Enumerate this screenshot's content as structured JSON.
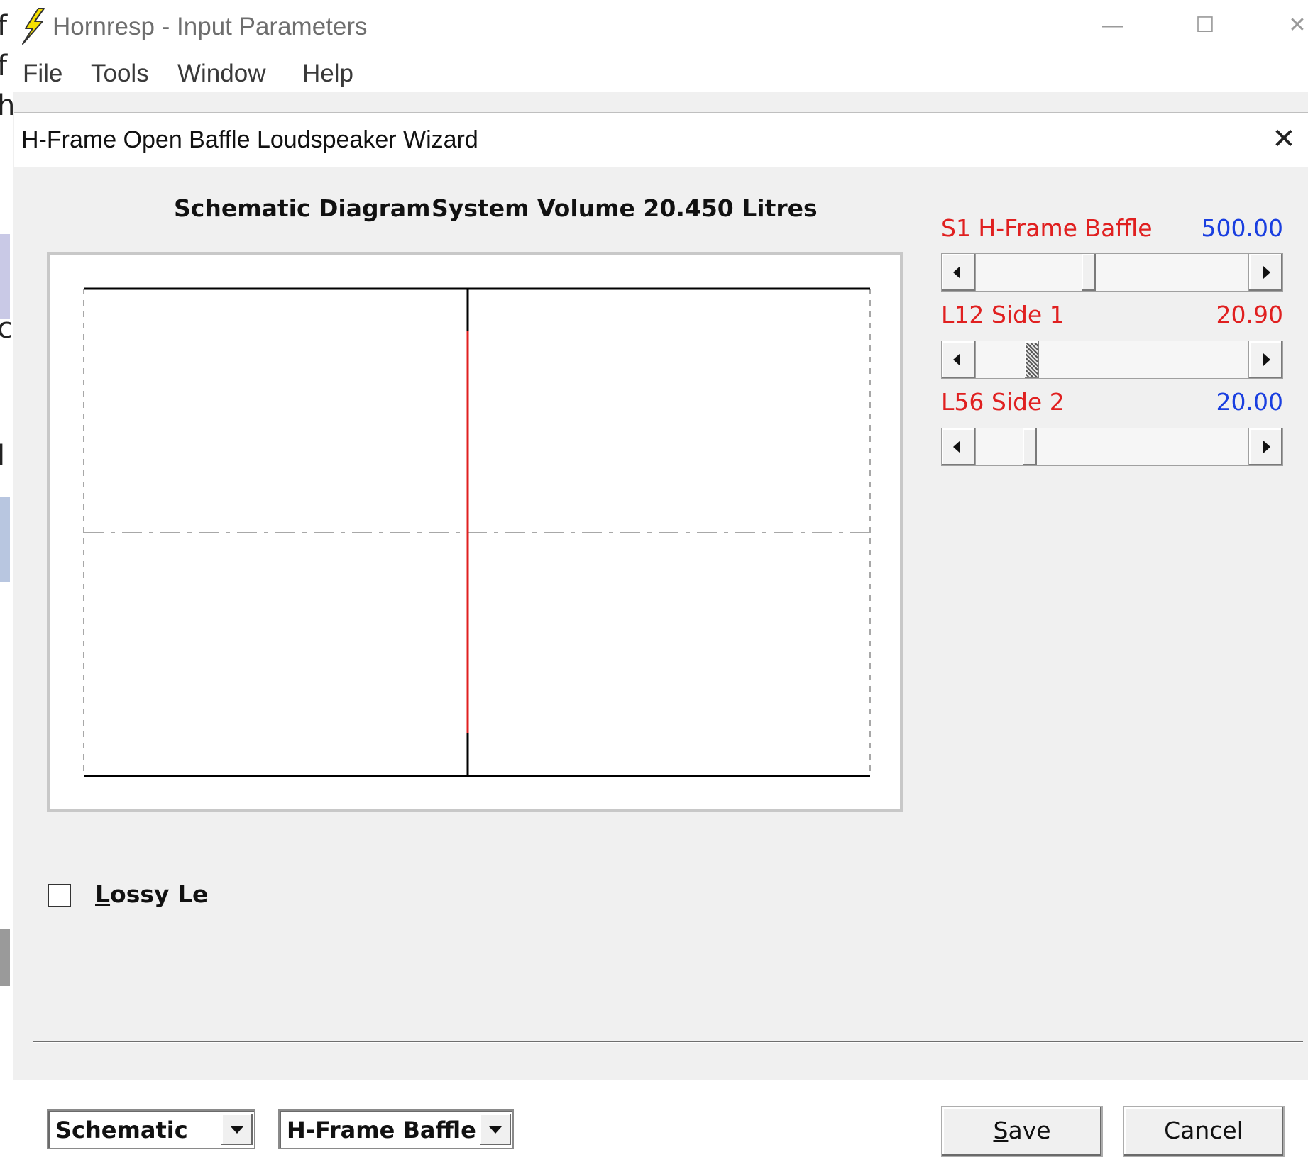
{
  "app": {
    "title": "Hornresp - Input Parameters",
    "menu": [
      "File",
      "Tools",
      "Window",
      "Help"
    ],
    "controls": {
      "minimize": "—",
      "maximize": "☐",
      "close": "✕"
    }
  },
  "dialog": {
    "title": "H-Frame Open Baffle Loudspeaker Wizard",
    "close": "✕",
    "heading_left": "Schematic Diagram",
    "heading_right": "System Volume 20.450 Litres"
  },
  "sliders": [
    {
      "label": "S1  H-Frame Baffle",
      "value": "500.00",
      "value_color": "#1a3fe0",
      "position": 0.41,
      "focused": false
    },
    {
      "label": "L12  Side 1",
      "value": "20.90",
      "value_color": "#e02020",
      "position": 0.19,
      "focused": true
    },
    {
      "label": "L56  Side 2",
      "value": "20.00",
      "value_color": "#1a3fe0",
      "position": 0.18,
      "focused": false
    }
  ],
  "checkbox": {
    "label_first": "L",
    "label_rest": "ossy Le",
    "checked": false
  },
  "combos": {
    "view": "Schematic",
    "type": "H-Frame Baffle"
  },
  "buttons": {
    "save_first": "S",
    "save_rest": "ave",
    "cancel": "Cancel"
  },
  "colors": {
    "baffle": "#e02020",
    "frame_line": "#000000",
    "guide_line": "#a8a8a8"
  },
  "icons": {
    "app": "lightning-bolt-icon"
  },
  "background_letters": [
    "f",
    "f",
    "h",
    "c",
    "l"
  ]
}
